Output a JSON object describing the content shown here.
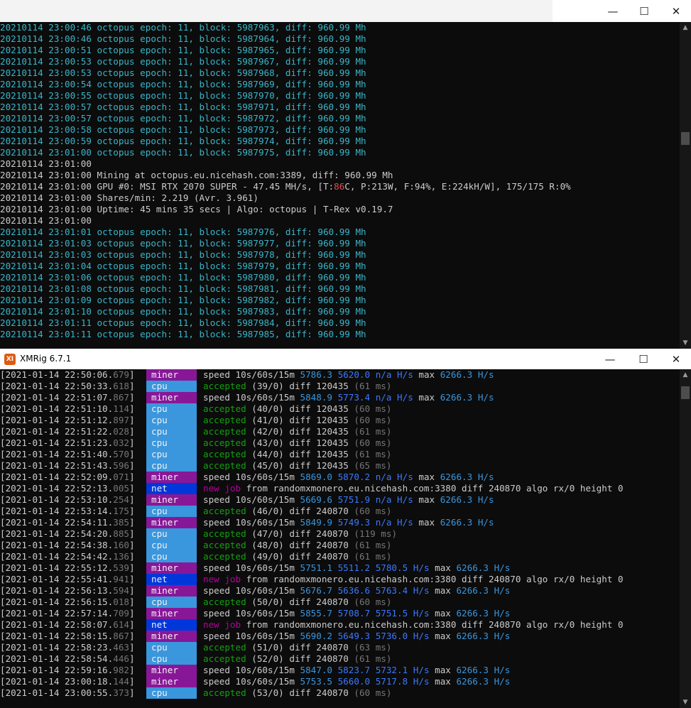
{
  "window1": {
    "controls": {
      "minimize": "—",
      "maximize": "☐",
      "close": "✕"
    },
    "lines_a": [
      {
        "ts": "20210114 23:00:46",
        "text": "octopus epoch: 11, block: 5987963, diff: 960.99 Mh"
      },
      {
        "ts": "20210114 23:00:46",
        "text": "octopus epoch: 11, block: 5987964, diff: 960.99 Mh"
      },
      {
        "ts": "20210114 23:00:51",
        "text": "octopus epoch: 11, block: 5987965, diff: 960.99 Mh"
      },
      {
        "ts": "20210114 23:00:53",
        "text": "octopus epoch: 11, block: 5987967, diff: 960.99 Mh"
      },
      {
        "ts": "20210114 23:00:53",
        "text": "octopus epoch: 11, block: 5987968, diff: 960.99 Mh"
      },
      {
        "ts": "20210114 23:00:54",
        "text": "octopus epoch: 11, block: 5987969, diff: 960.99 Mh"
      },
      {
        "ts": "20210114 23:00:55",
        "text": "octopus epoch: 11, block: 5987970, diff: 960.99 Mh"
      },
      {
        "ts": "20210114 23:00:57",
        "text": "octopus epoch: 11, block: 5987971, diff: 960.99 Mh"
      },
      {
        "ts": "20210114 23:00:57",
        "text": "octopus epoch: 11, block: 5987972, diff: 960.99 Mh"
      },
      {
        "ts": "20210114 23:00:58",
        "text": "octopus epoch: 11, block: 5987973, diff: 960.99 Mh"
      },
      {
        "ts": "20210114 23:00:59",
        "text": "octopus epoch: 11, block: 5987974, diff: 960.99 Mh"
      },
      {
        "ts": "20210114 23:01:00",
        "text": "octopus epoch: 11, block: 5987975, diff: 960.99 Mh"
      }
    ],
    "summary": {
      "blank1_ts": "20210114 23:01:00",
      "mining_ts": "20210114 23:01:00",
      "mining_text": "Mining at octopus.eu.nicehash.com:3389, diff: 960.99 Mh",
      "gpu_ts": "20210114 23:01:00",
      "gpu_pre": "GPU #0: MSI RTX 2070 SUPER - 47.45 MH/s, [T:",
      "gpu_temp": "86",
      "gpu_post": "C, P:213W, F:94%, E:224kH/W], 175/175 R:0%",
      "shares_ts": "20210114 23:01:00",
      "shares_text": "Shares/min: 2.219 (Avr. 3.961)",
      "uptime_ts": "20210114 23:01:00",
      "uptime_text": "Uptime: 45 mins 35 secs | Algo: octopus | T-Rex v0.19.7",
      "blank2_ts": "20210114 23:01:00"
    },
    "lines_b": [
      {
        "ts": "20210114 23:01:01",
        "text": "octopus epoch: 11, block: 5987976, diff: 960.99 Mh"
      },
      {
        "ts": "20210114 23:01:03",
        "text": "octopus epoch: 11, block: 5987977, diff: 960.99 Mh"
      },
      {
        "ts": "20210114 23:01:03",
        "text": "octopus epoch: 11, block: 5987978, diff: 960.99 Mh"
      },
      {
        "ts": "20210114 23:01:04",
        "text": "octopus epoch: 11, block: 5987979, diff: 960.99 Mh"
      },
      {
        "ts": "20210114 23:01:06",
        "text": "octopus epoch: 11, block: 5987980, diff: 960.99 Mh"
      },
      {
        "ts": "20210114 23:01:08",
        "text": "octopus epoch: 11, block: 5987981, diff: 960.99 Mh"
      },
      {
        "ts": "20210114 23:01:09",
        "text": "octopus epoch: 11, block: 5987982, diff: 960.99 Mh"
      },
      {
        "ts": "20210114 23:01:10",
        "text": "octopus epoch: 11, block: 5987983, diff: 960.99 Mh"
      },
      {
        "ts": "20210114 23:01:11",
        "text": "octopus epoch: 11, block: 5987984, diff: 960.99 Mh"
      },
      {
        "ts": "20210114 23:01:11",
        "text": "octopus epoch: 11, block: 5987985, diff: 960.99 Mh"
      }
    ]
  },
  "window2": {
    "title": "XMRig 6.7.1",
    "icon_text": "XI",
    "controls": {
      "minimize": "—",
      "maximize": "☐",
      "close": "✕"
    },
    "lines": [
      {
        "ts": "[2021-01-14 22:50:06.",
        "ms": "679",
        "tsend": "]",
        "tag": "miner",
        "kind": "speed",
        "s10": "5786.3",
        "s60": "5620.0",
        "s15": "n/a",
        "max": "6266.3"
      },
      {
        "ts": "[2021-01-14 22:50:33.",
        "ms": "618",
        "tsend": "]",
        "tag": "cpu",
        "kind": "accepted",
        "count": "(39/0)",
        "diff": "120435",
        "time": "(61 ms)"
      },
      {
        "ts": "[2021-01-14 22:51:07.",
        "ms": "867",
        "tsend": "]",
        "tag": "miner",
        "kind": "speed",
        "s10": "5848.9",
        "s60": "5773.4",
        "s15": "n/a",
        "max": "6266.3"
      },
      {
        "ts": "[2021-01-14 22:51:10.",
        "ms": "114",
        "tsend": "]",
        "tag": "cpu",
        "kind": "accepted",
        "count": "(40/0)",
        "diff": "120435",
        "time": "(60 ms)"
      },
      {
        "ts": "[2021-01-14 22:51:12.",
        "ms": "897",
        "tsend": "]",
        "tag": "cpu",
        "kind": "accepted",
        "count": "(41/0)",
        "diff": "120435",
        "time": "(60 ms)"
      },
      {
        "ts": "[2021-01-14 22:51:22.",
        "ms": "028",
        "tsend": "]",
        "tag": "cpu",
        "kind": "accepted",
        "count": "(42/0)",
        "diff": "120435",
        "time": "(61 ms)"
      },
      {
        "ts": "[2021-01-14 22:51:23.",
        "ms": "032",
        "tsend": "]",
        "tag": "cpu",
        "kind": "accepted",
        "count": "(43/0)",
        "diff": "120435",
        "time": "(60 ms)"
      },
      {
        "ts": "[2021-01-14 22:51:40.",
        "ms": "570",
        "tsend": "]",
        "tag": "cpu",
        "kind": "accepted",
        "count": "(44/0)",
        "diff": "120435",
        "time": "(61 ms)"
      },
      {
        "ts": "[2021-01-14 22:51:43.",
        "ms": "596",
        "tsend": "]",
        "tag": "cpu",
        "kind": "accepted",
        "count": "(45/0)",
        "diff": "120435",
        "time": "(65 ms)"
      },
      {
        "ts": "[2021-01-14 22:52:09.",
        "ms": "071",
        "tsend": "]",
        "tag": "miner",
        "kind": "speed",
        "s10": "5869.0",
        "s60": "5870.2",
        "s15": "n/a",
        "max": "6266.3"
      },
      {
        "ts": "[2021-01-14 22:52:13.",
        "ms": "005",
        "tsend": "]",
        "tag": "net",
        "kind": "job",
        "pool": "randomxmonero.eu.nicehash.com:3380",
        "diff": "240870",
        "algo": "rx/0",
        "height": "0"
      },
      {
        "ts": "[2021-01-14 22:53:10.",
        "ms": "254",
        "tsend": "]",
        "tag": "miner",
        "kind": "speed",
        "s10": "5669.6",
        "s60": "5751.9",
        "s15": "n/a",
        "max": "6266.3"
      },
      {
        "ts": "[2021-01-14 22:53:14.",
        "ms": "175",
        "tsend": "]",
        "tag": "cpu",
        "kind": "accepted",
        "count": "(46/0)",
        "diff": "240870",
        "time": "(60 ms)"
      },
      {
        "ts": "[2021-01-14 22:54:11.",
        "ms": "385",
        "tsend": "]",
        "tag": "miner",
        "kind": "speed",
        "s10": "5849.9",
        "s60": "5749.3",
        "s15": "n/a",
        "max": "6266.3"
      },
      {
        "ts": "[2021-01-14 22:54:20.",
        "ms": "885",
        "tsend": "]",
        "tag": "cpu",
        "kind": "accepted",
        "count": "(47/0)",
        "diff": "240870",
        "time": "(119 ms)"
      },
      {
        "ts": "[2021-01-14 22:54:38.",
        "ms": "160",
        "tsend": "]",
        "tag": "cpu",
        "kind": "accepted",
        "count": "(48/0)",
        "diff": "240870",
        "time": "(61 ms)"
      },
      {
        "ts": "[2021-01-14 22:54:42.",
        "ms": "136",
        "tsend": "]",
        "tag": "cpu",
        "kind": "accepted",
        "count": "(49/0)",
        "diff": "240870",
        "time": "(61 ms)"
      },
      {
        "ts": "[2021-01-14 22:55:12.",
        "ms": "539",
        "tsend": "]",
        "tag": "miner",
        "kind": "speed",
        "s10": "5751.1",
        "s60": "5511.2",
        "s15": "5780.5",
        "max": "6266.3"
      },
      {
        "ts": "[2021-01-14 22:55:41.",
        "ms": "941",
        "tsend": "]",
        "tag": "net",
        "kind": "job",
        "pool": "randomxmonero.eu.nicehash.com:3380",
        "diff": "240870",
        "algo": "rx/0",
        "height": "0"
      },
      {
        "ts": "[2021-01-14 22:56:13.",
        "ms": "594",
        "tsend": "]",
        "tag": "miner",
        "kind": "speed",
        "s10": "5676.7",
        "s60": "5636.6",
        "s15": "5763.4",
        "max": "6266.3"
      },
      {
        "ts": "[2021-01-14 22:56:15.",
        "ms": "018",
        "tsend": "]",
        "tag": "cpu",
        "kind": "accepted",
        "count": "(50/0)",
        "diff": "240870",
        "time": "(60 ms)"
      },
      {
        "ts": "[2021-01-14 22:57:14.",
        "ms": "709",
        "tsend": "]",
        "tag": "miner",
        "kind": "speed",
        "s10": "5855.7",
        "s60": "5708.7",
        "s15": "5751.5",
        "max": "6266.3"
      },
      {
        "ts": "[2021-01-14 22:58:07.",
        "ms": "614",
        "tsend": "]",
        "tag": "net",
        "kind": "job",
        "pool": "randomxmonero.eu.nicehash.com:3380",
        "diff": "240870",
        "algo": "rx/0",
        "height": "0"
      },
      {
        "ts": "[2021-01-14 22:58:15.",
        "ms": "867",
        "tsend": "]",
        "tag": "miner",
        "kind": "speed",
        "s10": "5690.2",
        "s60": "5649.3",
        "s15": "5736.0",
        "max": "6266.3"
      },
      {
        "ts": "[2021-01-14 22:58:23.",
        "ms": "463",
        "tsend": "]",
        "tag": "cpu",
        "kind": "accepted",
        "count": "(51/0)",
        "diff": "240870",
        "time": "(63 ms)"
      },
      {
        "ts": "[2021-01-14 22:58:54.",
        "ms": "446",
        "tsend": "]",
        "tag": "cpu",
        "kind": "accepted",
        "count": "(52/0)",
        "diff": "240870",
        "time": "(61 ms)"
      },
      {
        "ts": "[2021-01-14 22:59:16.",
        "ms": "982",
        "tsend": "]",
        "tag": "miner",
        "kind": "speed",
        "s10": "5847.0",
        "s60": "5823.7",
        "s15": "5732.1",
        "max": "6266.3"
      },
      {
        "ts": "[2021-01-14 23:00:18.",
        "ms": "144",
        "tsend": "]",
        "tag": "miner",
        "kind": "speed",
        "s10": "5753.5",
        "s60": "5660.0",
        "s15": "5717.8",
        "max": "6266.3"
      },
      {
        "ts": "[2021-01-14 23:00:55.",
        "ms": "373",
        "tsend": "]",
        "tag": "cpu",
        "kind": "accepted",
        "count": "(53/0)",
        "diff": "240870",
        "time": "(60 ms)"
      }
    ],
    "labels": {
      "speed": "speed 10s/60s/15m",
      "hs": "H/s",
      "max": "max",
      "accepted": "accepted",
      "diff": "diff",
      "newjob": "new job",
      "from": "from",
      "algo": "algo",
      "height": "height"
    }
  },
  "colors": {
    "terminal_bg": "#0c0c0c",
    "teal": "#3ab5c9",
    "red": "#e74856",
    "miner_tag": "#881798",
    "cpu_tag": "#3a96dd",
    "net_tag": "#0037da",
    "green": "#13a10e",
    "magenta": "#b4009e"
  },
  "icons": [
    "minimize-icon",
    "maximize-icon",
    "close-icon",
    "scroll-up-icon",
    "scroll-down-icon",
    "xmrig-app-icon"
  ]
}
